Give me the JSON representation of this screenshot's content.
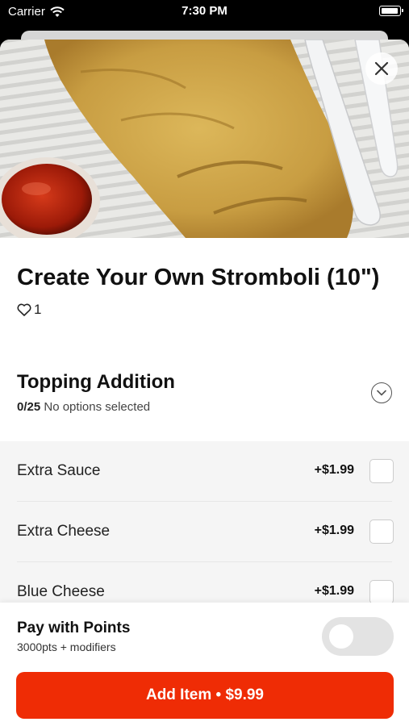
{
  "status_bar": {
    "carrier": "Carrier",
    "time": "7:30 PM"
  },
  "item": {
    "title": "Create Your Own Stromboli (10\")",
    "like_count": "1"
  },
  "modifier_group": {
    "title": "Topping Addition",
    "count": "0/25",
    "status": "No options selected",
    "options": [
      {
        "label": "Extra Sauce",
        "price": "+$1.99",
        "checked": false
      },
      {
        "label": "Extra Cheese",
        "price": "+$1.99",
        "checked": false
      },
      {
        "label": "Blue Cheese",
        "price": "+$1.99",
        "checked": false
      }
    ]
  },
  "footer": {
    "points_title": "Pay with Points",
    "points_subtitle": "3000pts + modifiers",
    "points_toggle_on": false,
    "add_button_label": "Add Item • $9.99"
  },
  "colors": {
    "accent": "#ef2c05",
    "options_bg": "#f5f5f5"
  }
}
